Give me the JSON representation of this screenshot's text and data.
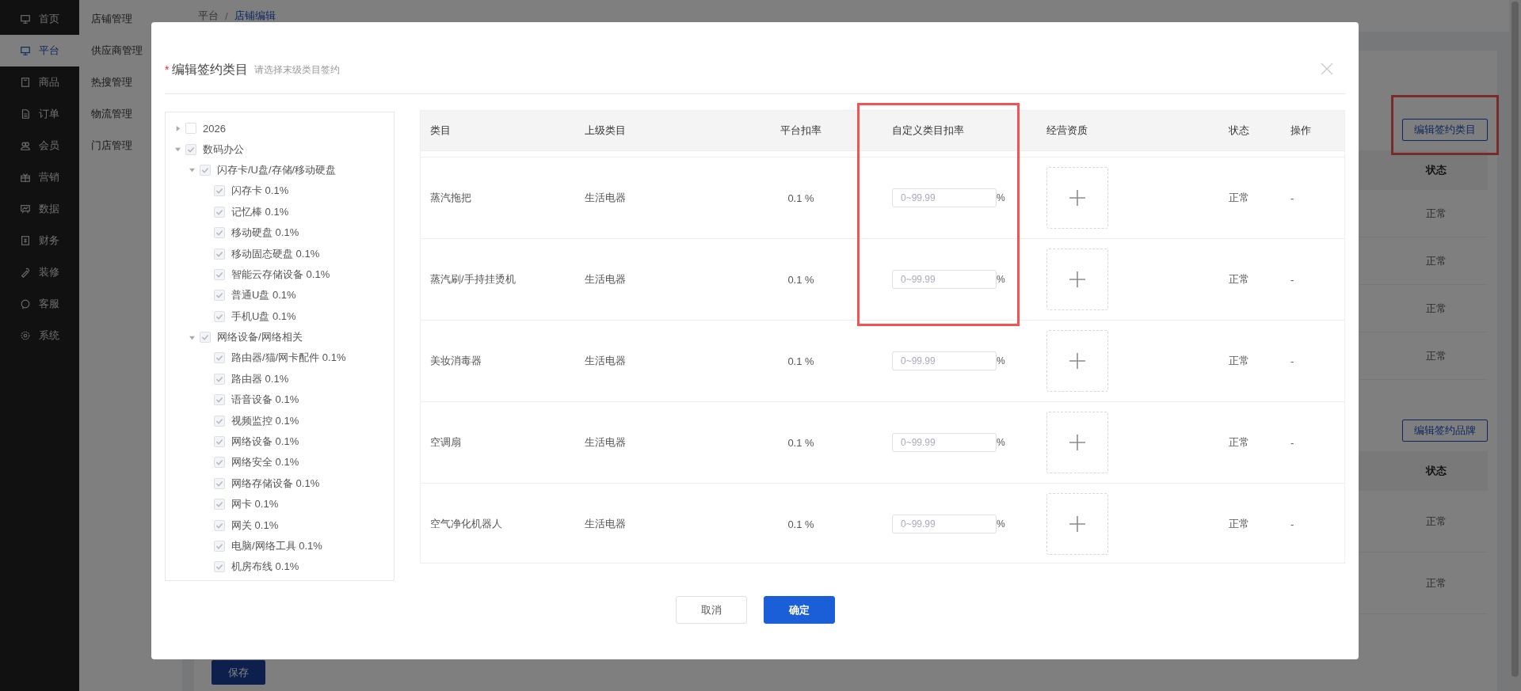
{
  "sidebar": {
    "items": [
      {
        "label": "首页",
        "selected": false
      },
      {
        "label": "平台",
        "selected": true
      },
      {
        "label": "商品",
        "selected": false
      },
      {
        "label": "订单",
        "selected": false
      },
      {
        "label": "会员",
        "selected": false
      },
      {
        "label": "营销",
        "selected": false
      },
      {
        "label": "数据",
        "selected": false
      },
      {
        "label": "财务",
        "selected": false
      },
      {
        "label": "装修",
        "selected": false
      },
      {
        "label": "客服",
        "selected": false
      },
      {
        "label": "系统",
        "selected": false
      }
    ]
  },
  "submenu": {
    "items": [
      "店铺管理",
      "供应商管理",
      "热搜管理",
      "物流管理",
      "门店管理"
    ]
  },
  "breadcrumb": {
    "items": [
      "平台",
      "店铺编辑"
    ],
    "separator": "/"
  },
  "page": {
    "sections": [
      {
        "button": "编辑签约类目",
        "highlighted": true,
        "status_header": "状态",
        "rows": [
          "正常",
          "正常",
          "正常",
          "正常"
        ]
      },
      {
        "button": "编辑签约品牌",
        "status_header": "状态",
        "rows": [
          "正常",
          "正常"
        ]
      }
    ],
    "save_button": "保存"
  },
  "modal": {
    "required_mark": "*",
    "title": "编辑签约类目",
    "hint": "请选择末级类目签约",
    "tree": [
      {
        "label": "2026",
        "expanded": false,
        "checked": false
      },
      {
        "label": "数码办公",
        "expanded": true,
        "checked": true,
        "children": [
          {
            "label": "闪存卡/U盘/存储/移动硬盘",
            "expanded": true,
            "checked": true,
            "children": [
              {
                "label": "闪存卡 0.1%",
                "checked": true
              },
              {
                "label": "记忆棒 0.1%",
                "checked": true
              },
              {
                "label": "移动硬盘 0.1%",
                "checked": true
              },
              {
                "label": "移动固态硬盘 0.1%",
                "checked": true
              },
              {
                "label": "智能云存储设备 0.1%",
                "checked": true
              },
              {
                "label": "普通U盘 0.1%",
                "checked": true
              },
              {
                "label": "手机U盘 0.1%",
                "checked": true
              }
            ]
          },
          {
            "label": "网络设备/网络相关",
            "expanded": true,
            "checked": true,
            "children": [
              {
                "label": "路由器/猫/网卡配件 0.1%",
                "checked": true
              },
              {
                "label": "路由器 0.1%",
                "checked": true
              },
              {
                "label": "语音设备 0.1%",
                "checked": true
              },
              {
                "label": "视频监控 0.1%",
                "checked": true
              },
              {
                "label": "网络设备 0.1%",
                "checked": true
              },
              {
                "label": "网络安全 0.1%",
                "checked": true
              },
              {
                "label": "网络存储设备 0.1%",
                "checked": true
              },
              {
                "label": "网卡 0.1%",
                "checked": true
              },
              {
                "label": "网关 0.1%",
                "checked": true
              },
              {
                "label": "电脑/网络工具 0.1%",
                "checked": true
              },
              {
                "label": "机房布线 0.1%",
                "checked": true
              }
            ]
          }
        ]
      }
    ],
    "table": {
      "custom_rate_highlighted": true,
      "columns": [
        "类目",
        "上级类目",
        "平台扣率",
        "自定义类目扣率",
        "经营资质",
        "状态",
        "操作"
      ],
      "rows": [
        {
          "category": "蒸汽拖把",
          "parent": "生活电器",
          "platform_rate": "0.1 %",
          "custom_rate_placeholder": "0~99.99",
          "unit": "%",
          "status": "正常",
          "action": "-"
        },
        {
          "category": "蒸汽刷/手持挂烫机",
          "parent": "生活电器",
          "platform_rate": "0.1 %",
          "custom_rate_placeholder": "0~99.99",
          "unit": "%",
          "status": "正常",
          "action": "-"
        },
        {
          "category": "美妆消毒器",
          "parent": "生活电器",
          "platform_rate": "0.1 %",
          "custom_rate_placeholder": "0~99.99",
          "unit": "%",
          "status": "正常",
          "action": "-"
        },
        {
          "category": "空调扇",
          "parent": "生活电器",
          "platform_rate": "0.1 %",
          "custom_rate_placeholder": "0~99.99",
          "unit": "%",
          "status": "正常",
          "action": "-"
        },
        {
          "category": "空气净化机器人",
          "parent": "生活电器",
          "platform_rate": "0.1 %",
          "custom_rate_placeholder": "0~99.99",
          "unit": "%",
          "status": "正常",
          "action": "-"
        }
      ]
    },
    "buttons": [
      {
        "label": "取消",
        "kind": "default"
      },
      {
        "label": "确定",
        "kind": "primary"
      }
    ]
  }
}
